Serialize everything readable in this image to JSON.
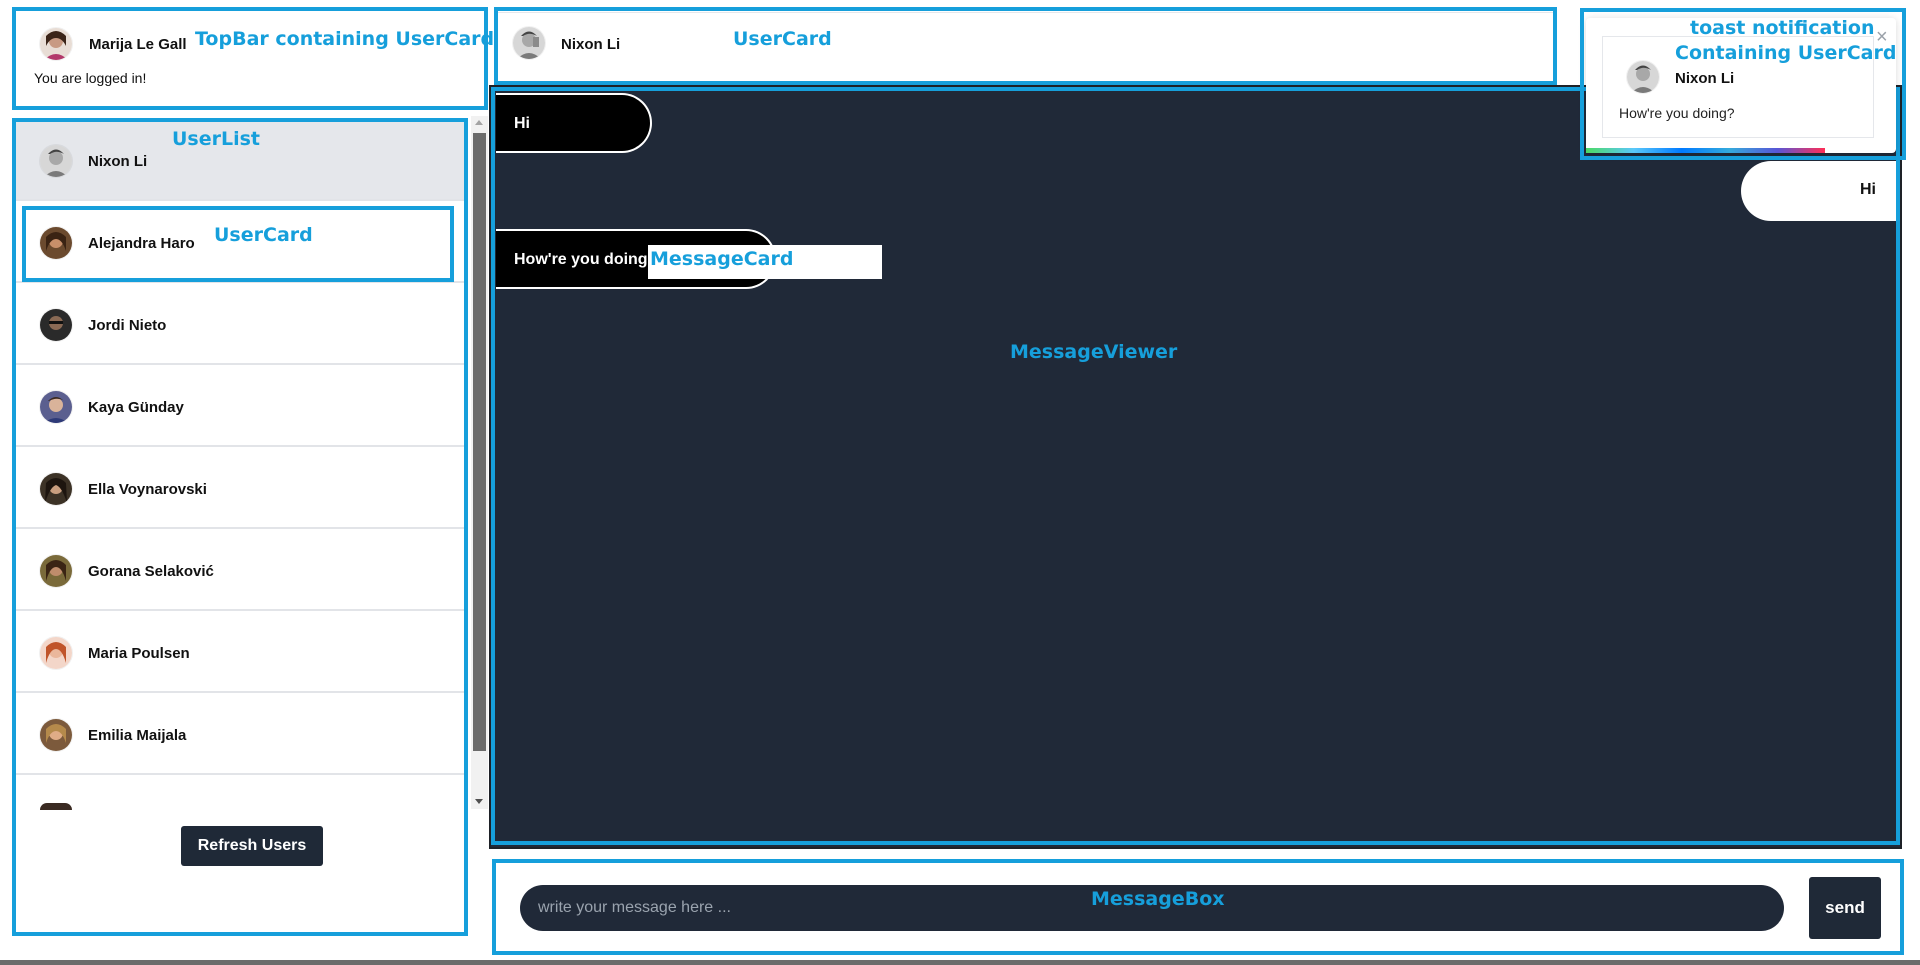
{
  "topbar": {
    "user_name": "Marija Le Gall",
    "status_text": "You are logged in!",
    "annotation": "TopBar containing UserCard"
  },
  "header": {
    "user_name": "Nixon Li",
    "annotation": "UserCard"
  },
  "toast": {
    "title_annotation": "toast notification",
    "title_annotation_2": "Containing UserCard",
    "user_name": "Nixon Li",
    "message": "How're you doing?",
    "close_glyph": "×",
    "progress": 0.77
  },
  "user_list": {
    "annotation": "UserList",
    "selected_annotation": "UserCard",
    "users": [
      {
        "name": "Nixon Li"
      },
      {
        "name": "Alejandra Haro"
      },
      {
        "name": "Jordi Nieto"
      },
      {
        "name": "Kaya Günday"
      },
      {
        "name": "Ella Voynarovski"
      },
      {
        "name": "Gorana Selaković"
      },
      {
        "name": "Maria Poulsen"
      },
      {
        "name": "Emilia Maijala"
      }
    ],
    "refresh_label": "Refresh Users"
  },
  "messages": {
    "annotation": "MessageViewer",
    "card_annotation": "MessageCard",
    "items": [
      {
        "text": "Hi",
        "side": "left"
      },
      {
        "text": "Hi",
        "side": "right"
      },
      {
        "text": "How're you doing",
        "side": "left"
      }
    ]
  },
  "message_box": {
    "annotation": "MessageBox",
    "placeholder": "write your message here ...",
    "send_label": "send"
  },
  "colors": {
    "annotation": "#169fdb",
    "viewer_bg": "#202938",
    "input_bg": "#202938",
    "button_bg": "#1f2937",
    "selected_row": "#e5e7eb"
  }
}
